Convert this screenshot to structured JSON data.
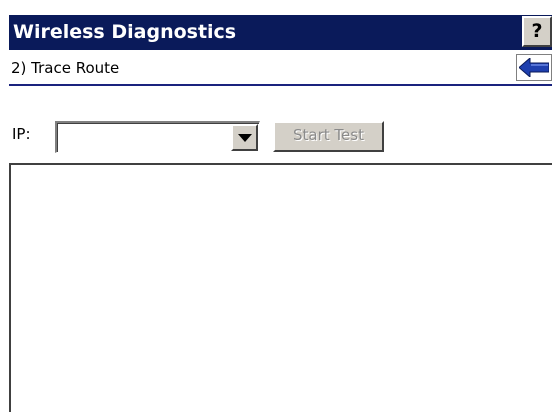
{
  "window": {
    "title": "Wireless Diagnostics",
    "help_label": "?"
  },
  "header": {
    "subtitle": "2) Trace Route",
    "back_icon": "back-arrow-icon"
  },
  "form": {
    "ip_label": "IP:",
    "ip_value": "",
    "dropdown_icon": "chevron-down-icon",
    "start_button_label": "Start Test",
    "start_button_enabled": false
  },
  "output": {
    "text": ""
  },
  "colors": {
    "title_bar": "#0a1a5a",
    "divider": "#1a237e",
    "arrow": "#1e3fae",
    "button_face": "#d4d0c8"
  }
}
